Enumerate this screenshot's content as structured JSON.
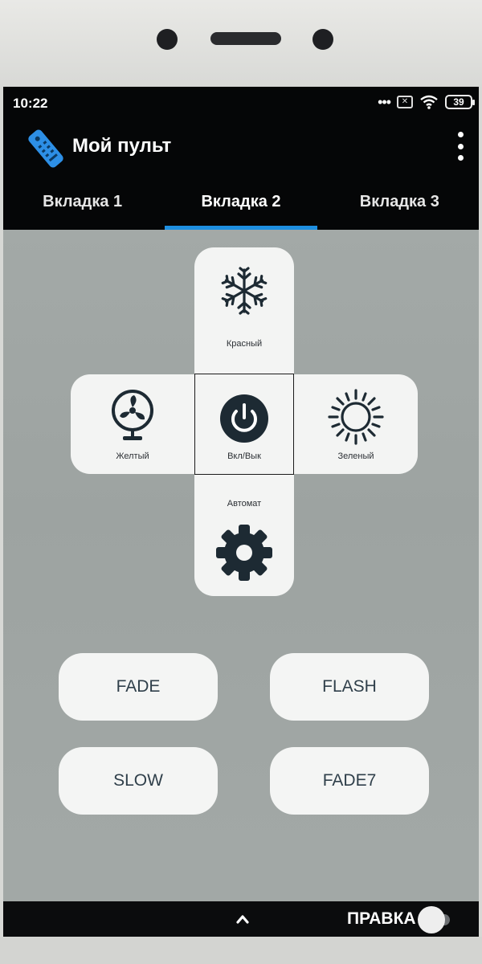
{
  "status_bar": {
    "time": "10:22",
    "battery": "39",
    "icons": [
      "more-dots-icon",
      "sim-off-icon",
      "wifi-icon",
      "battery-icon"
    ]
  },
  "app_bar": {
    "title": "Мой пульт",
    "logo_icon": "remote-control-icon",
    "menu_icon": "overflow-menu-icon"
  },
  "tabs": [
    {
      "label": "Вкладка 1",
      "active": false
    },
    {
      "label": "Вкладка 2",
      "active": true
    },
    {
      "label": "Вкладка 3",
      "active": false
    }
  ],
  "remote": {
    "top": {
      "label": "Красный",
      "icon": "snowflake-icon"
    },
    "left": {
      "label": "Желтый",
      "icon": "fan-icon"
    },
    "center": {
      "label": "Вкл/Вык",
      "icon": "power-icon"
    },
    "right": {
      "label": "Зеленый",
      "icon": "sun-icon"
    },
    "bottom": {
      "label": "Автомат",
      "icon": "gear-icon"
    }
  },
  "modes": [
    "FADE",
    "FLASH",
    "SLOW",
    "FADE7"
  ],
  "bottom_bar": {
    "edit_label": "ПРАВКА",
    "edit_enabled": false
  },
  "colors": {
    "accent": "#1e8fe0",
    "app_bar": "#050607",
    "screen_bg": "#a3a9a7",
    "button_bg": "#f4f5f4",
    "icon_dark": "#1d2a33"
  }
}
